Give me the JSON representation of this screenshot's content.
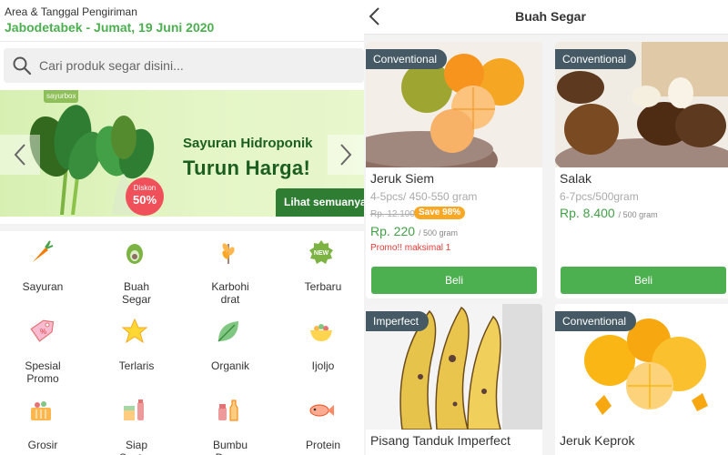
{
  "colors": {
    "green": "#4caf50",
    "dark_green": "#2e7d32",
    "tag": "#455a64",
    "save": "#f9a825",
    "promo": "#e53935"
  },
  "area": {
    "label": "Area & Tanggal Pengiriman",
    "value": "Jabodetabek - Jumat, 19 Juni 2020"
  },
  "search": {
    "placeholder": "Cari produk segar disini...",
    "icon": "search-icon"
  },
  "banner": {
    "logo": "sayurbox",
    "title_line1": "Sayuran Hidroponik",
    "title_line2": "Turun Harga!",
    "badge_top": "Diskon",
    "badge_value": "50%",
    "cta": "Lihat semuanya",
    "slides": 5,
    "active_slide": 3
  },
  "categories": [
    {
      "label": "Sayuran",
      "icon": "carrot-icon"
    },
    {
      "label": "Buah\nSegar",
      "icon": "avocado-icon"
    },
    {
      "label": "Karbohi\ndrat",
      "icon": "wheat-icon"
    },
    {
      "label": "Terbaru",
      "icon": "new-badge-icon"
    },
    {
      "label": "Spesial\nPromo",
      "icon": "promo-tag-icon"
    },
    {
      "label": "Terlaris",
      "icon": "star-icon"
    },
    {
      "label": "Organik",
      "icon": "leaf-icon"
    },
    {
      "label": "Ijoljo",
      "icon": "bowl-icon"
    },
    {
      "label": "Grosir",
      "icon": "basket-icon"
    },
    {
      "label": "Siap\nSantap",
      "icon": "ready-meal-icon"
    },
    {
      "label": "Bumbu\nDapur",
      "icon": "spice-bottle-icon"
    },
    {
      "label": "Protein",
      "icon": "fish-icon"
    }
  ],
  "right": {
    "title": "Buah Segar",
    "products": [
      {
        "tag": "Conventional",
        "name": "Jeruk Siem",
        "unit": "4-5pcs/ 450-550 gram",
        "old_price": "Rp. 12.100",
        "save": "Save 98%",
        "price": "Rp. 220",
        "price_unit": "/ 500 gram",
        "promo": "Promo!! maksimal 1",
        "button": "Beli",
        "image": "orange-icon"
      },
      {
        "tag": "Conventional",
        "name": "Salak",
        "unit": "6-7pcs/500gram",
        "old_price": "",
        "save": "",
        "price": "Rp. 8.400",
        "price_unit": "/ 500 gram",
        "promo": "",
        "button": "Beli",
        "image": "snakefruit-icon"
      },
      {
        "tag": "Imperfect",
        "name": "Pisang Tanduk Imperfect",
        "unit": "",
        "old_price": "",
        "save": "",
        "price": "",
        "price_unit": "",
        "promo": "",
        "button": "",
        "image": "banana-icon"
      },
      {
        "tag": "Conventional",
        "name": "Jeruk Keprok",
        "unit": "",
        "old_price": "",
        "save": "",
        "price": "",
        "price_unit": "",
        "promo": "",
        "button": "",
        "image": "tangerine-icon"
      }
    ]
  }
}
